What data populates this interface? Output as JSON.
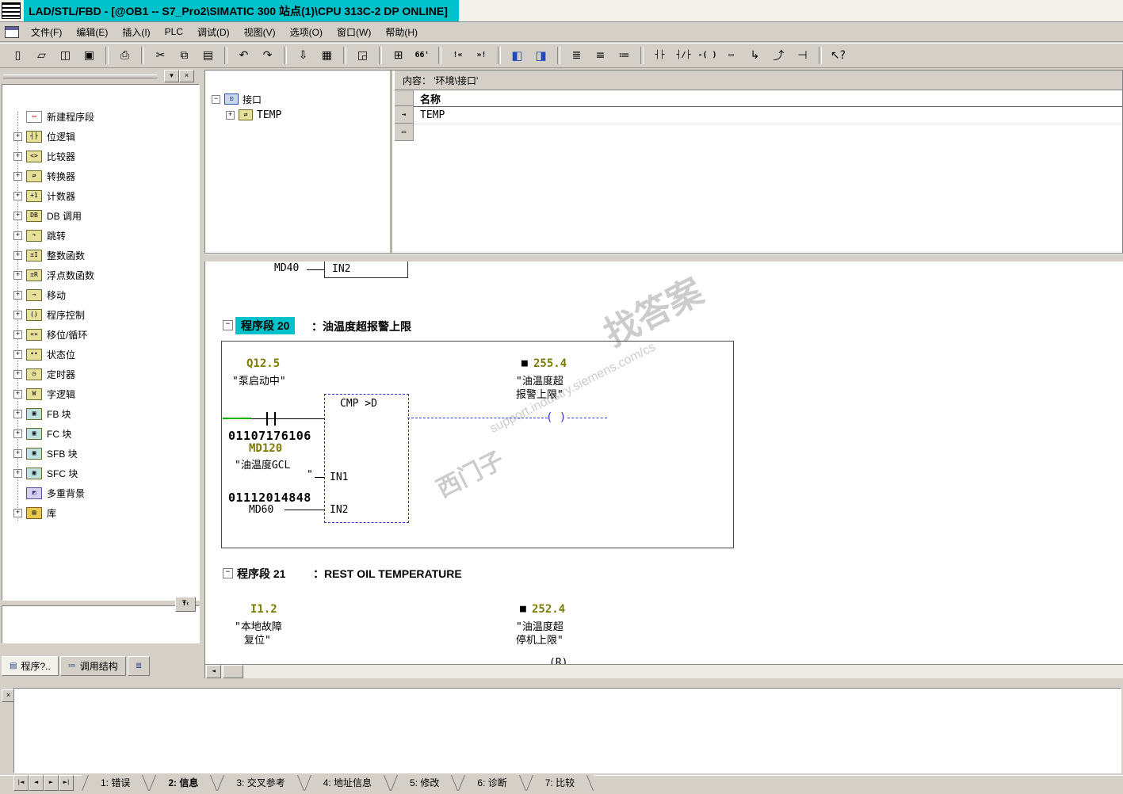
{
  "window": {
    "title": "LAD/STL/FBD  - [@OB1 -- S7_Pro2\\SIMATIC 300 站点(1)\\CPU 313C-2 DP  ONLINE]",
    "accent_color": "#00c2ca"
  },
  "menu": {
    "items": [
      "文件(F)",
      "编辑(E)",
      "插入(I)",
      "PLC",
      "调试(D)",
      "视图(V)",
      "选项(O)",
      "窗口(W)",
      "帮助(H)"
    ]
  },
  "toolbar": {
    "buttons": [
      {
        "name": "new",
        "glyph": "▯"
      },
      {
        "name": "open",
        "glyph": "▱"
      },
      {
        "name": "open-online",
        "glyph": "◫"
      },
      {
        "name": "save",
        "glyph": "▣"
      },
      {
        "name": "print",
        "glyph": "⎙"
      },
      {
        "name": "cut",
        "glyph": "✂"
      },
      {
        "name": "copy",
        "glyph": "⧉"
      },
      {
        "name": "paste",
        "glyph": "▤"
      },
      {
        "name": "undo",
        "glyph": "↶"
      },
      {
        "name": "redo",
        "glyph": "↷"
      },
      {
        "name": "download",
        "glyph": "⇩"
      },
      {
        "name": "monitor-table",
        "glyph": "▦"
      },
      {
        "name": "address-box",
        "glyph": "◲"
      },
      {
        "name": "symbol-display",
        "glyph": "⊞"
      },
      {
        "name": "monitor",
        "glyph": "66'"
      },
      {
        "name": "prev-error",
        "glyph": "!«"
      },
      {
        "name": "next-error",
        "glyph": "»!"
      },
      {
        "name": "view-lad",
        "glyph": "◧"
      },
      {
        "name": "view-split",
        "glyph": "◨"
      },
      {
        "name": "list-networks",
        "glyph": "≣"
      },
      {
        "name": "list-symbols",
        "glyph": "≡"
      },
      {
        "name": "list-comments",
        "glyph": "≔"
      },
      {
        "name": "contact-no",
        "glyph": "┤├"
      },
      {
        "name": "contact-nc",
        "glyph": "┤/├"
      },
      {
        "name": "coil",
        "glyph": "-( )"
      },
      {
        "name": "empty-box",
        "glyph": "▭"
      },
      {
        "name": "open-branch",
        "glyph": "↳"
      },
      {
        "name": "close-branch",
        "glyph": "⤴"
      },
      {
        "name": "negate",
        "glyph": "⊣"
      },
      {
        "name": "help",
        "glyph": "↖?"
      }
    ]
  },
  "sidebar": {
    "menu_glyph": "▾",
    "close_glyph": "×",
    "detail_button_glyph": "Ŧ‹",
    "tree": [
      {
        "label": "新建程序段",
        "glyph": "▭"
      },
      {
        "label": "位逻辑",
        "glyph": "┤├"
      },
      {
        "label": "比较器",
        "glyph": "<>"
      },
      {
        "label": "转换器",
        "glyph": "⇄"
      },
      {
        "label": "计数器",
        "glyph": "+1"
      },
      {
        "label": "DB 调用",
        "glyph": "DB"
      },
      {
        "label": "跳转",
        "glyph": "↷"
      },
      {
        "label": "整数函数",
        "glyph": "±I"
      },
      {
        "label": "浮点数函数",
        "glyph": "±R"
      },
      {
        "label": "移动",
        "glyph": "→"
      },
      {
        "label": "程序控制",
        "glyph": "()"
      },
      {
        "label": "移位/循环",
        "glyph": "«»"
      },
      {
        "label": "状态位",
        "glyph": "••"
      },
      {
        "label": "定时器",
        "glyph": "◷"
      },
      {
        "label": "字逻辑",
        "glyph": "W"
      },
      {
        "label": "FB 块",
        "glyph": "▣"
      },
      {
        "label": "FC 块",
        "glyph": "▣"
      },
      {
        "label": "SFB 块",
        "glyph": "▣"
      },
      {
        "label": "SFC 块",
        "glyph": "▣"
      },
      {
        "label": "多重背景",
        "glyph": "◩"
      },
      {
        "label": "库",
        "glyph": "▤"
      }
    ],
    "tabs": [
      {
        "label": "程序?..",
        "glyph": "▤"
      },
      {
        "label": "调用结构",
        "glyph": "≔"
      },
      {
        "label": "",
        "glyph": "≣"
      }
    ]
  },
  "declaration": {
    "root": "接口",
    "child": "TEMP",
    "content_header": "内容：  '环境\\接口'",
    "name_header": "名称",
    "row1": "TEMP"
  },
  "editor": {
    "partial": {
      "operand": "MD40",
      "param": "IN2"
    },
    "net20": {
      "title": "程序段  20",
      "comment": "：油温度超报警上限",
      "contact_addr": "Q12.5",
      "contact_sym": "\"泵启动中\"",
      "cmp_title": "CMP >D",
      "in1_status": "01107176106",
      "in1_addr": "MD120",
      "in1_sym": "\"油温度GCL",
      "in1_sym2": "\"",
      "in1_param": "IN1",
      "in2_status": "01112014848",
      "in2_addr": "MD60",
      "in2_param": "IN2",
      "coil_box": "■",
      "coil_addr": "255.4",
      "coil_sym1": "\"油温度超",
      "coil_sym2": "报警上限\"",
      "coil": "(  )"
    },
    "net21": {
      "title": "程序段  21",
      "comment": "：REST OIL TEMPERATURE",
      "contact_addr": "I1.2",
      "contact_sym1": "\"本地故障",
      "contact_sym2": "复位\"",
      "coil_box": "■",
      "coil_addr": "252.4",
      "coil_sym1": "\"油温度超",
      "coil_sym2": "停机上限\"",
      "partial_coil": "(R)"
    },
    "watermark": {
      "line1": "找答案",
      "line2": "support.industry.siemens.com/cs",
      "line3": "西门子"
    }
  },
  "scrollbar": {
    "left_arrow": "◄"
  },
  "output": {
    "close": "×",
    "nav": [
      "|◄",
      "◄",
      "►",
      "►|"
    ],
    "tabs": [
      "1: 错误",
      "2: 信息",
      "3: 交叉参考",
      "4: 地址信息",
      "5: 修改",
      "6: 诊断",
      "7: 比较"
    ],
    "active_tab_index": 1
  }
}
